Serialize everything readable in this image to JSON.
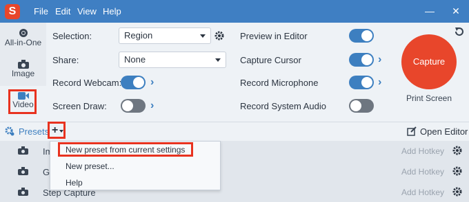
{
  "titlebar": {
    "logo_letter": "S",
    "menu": [
      "File",
      "Edit",
      "View",
      "Help"
    ],
    "minimize": "—",
    "close": "✕"
  },
  "modes": {
    "all_in_one": "All-in-One",
    "image": "Image",
    "video": "Video",
    "selected": "Video"
  },
  "settings": {
    "selection_label": "Selection:",
    "selection_value": "Region",
    "share_label": "Share:",
    "share_value": "None",
    "webcam_label": "Record Webcam:",
    "webcam_on": true,
    "screen_draw_label": "Screen Draw:",
    "screen_draw_on": false,
    "preview_label": "Preview in Editor",
    "preview_on": true,
    "cursor_label": "Capture Cursor",
    "cursor_on": true,
    "mic_label": "Record Microphone",
    "mic_on": true,
    "system_audio_label": "Record System Audio",
    "system_audio_on": false
  },
  "capture": {
    "button_label": "Capture",
    "hotkey_text": "Print Screen"
  },
  "presets": {
    "label": "Presets",
    "add_symbol": "+",
    "open_editor": "Open Editor",
    "rows": [
      {
        "name": "Im",
        "hotkey": "Add Hotkey"
      },
      {
        "name": "Gi",
        "hotkey": "Add Hotkey"
      },
      {
        "name": "Step Capture",
        "hotkey": "Add Hotkey"
      }
    ]
  },
  "popup": {
    "items": [
      "New preset from current settings",
      "New preset...",
      "Help"
    ]
  },
  "colors": {
    "titlebar": "#3f7fc3",
    "accent": "#3d7fc0",
    "capture": "#e8462b",
    "highlight_box": "#e8321f"
  }
}
